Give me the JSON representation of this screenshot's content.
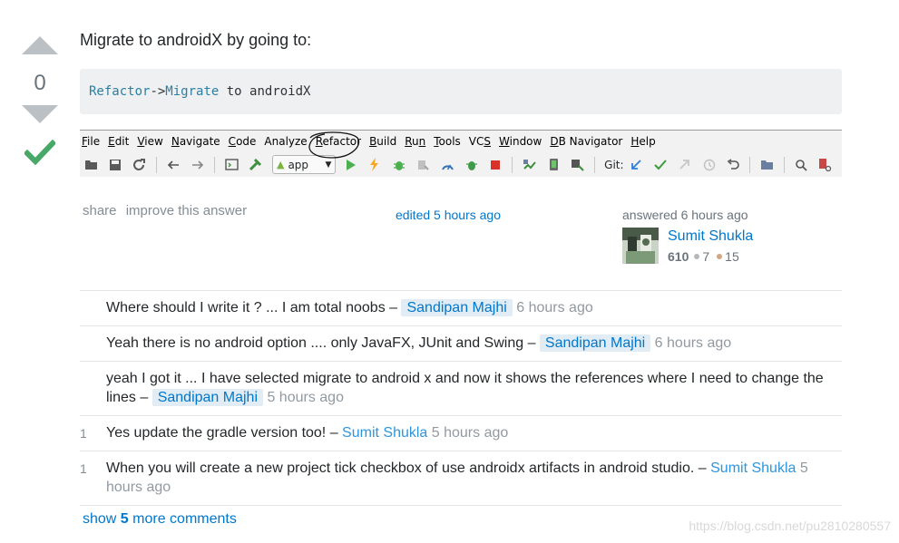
{
  "vote": {
    "count": "0"
  },
  "post": {
    "intro": "Migrate to androidX by going to:",
    "code": {
      "menu1": "Refactor",
      "sep": "->",
      "menu2": "Migrate",
      "rest": " to androidX"
    }
  },
  "ide": {
    "menus": [
      {
        "u": "F",
        "r": "ile"
      },
      {
        "u": "E",
        "r": "dit"
      },
      {
        "u": "V",
        "r": "iew"
      },
      {
        "u": "N",
        "r": "avigate"
      },
      {
        "u": "C",
        "r": "ode"
      },
      {
        "u": "",
        "r": "Analyze"
      },
      {
        "u": "R",
        "r": "efactor"
      },
      {
        "u": "B",
        "r": "uild"
      },
      {
        "u": "R",
        "r": "u",
        "r2": "n"
      },
      {
        "u": "T",
        "r": "ools"
      },
      {
        "u": "",
        "r": "VC",
        "u2": "S"
      },
      {
        "u": "W",
        "r": "indow"
      },
      {
        "u": "D",
        "r": "B Navigator"
      },
      {
        "u": "H",
        "r": "elp"
      }
    ],
    "run_config": "app",
    "git_label": "Git:",
    "colors": {
      "green": "#4caf50",
      "blue": "#2f7ed8",
      "red": "#d9322b",
      "orange": "#f5a623"
    }
  },
  "meta": {
    "share": "share",
    "improve": "improve this answer",
    "edited": "edited 5 hours ago",
    "answered": "answered 6 hours ago",
    "user_name": "Sumit Shukla",
    "rep": "610",
    "silver": "7",
    "bronze": "15"
  },
  "comments": [
    {
      "score": "",
      "text": "Where should I write it ? ... I am total noobs – ",
      "author": "Sandipan Majhi",
      "date": "6 hours ago",
      "highlight": true
    },
    {
      "score": "",
      "text": "Yeah there is no android option .... only JavaFX, JUnit and Swing – ",
      "author": "Sandipan Majhi",
      "date": "6 hours ago",
      "highlight": true
    },
    {
      "score": "",
      "text": "yeah I got it ... I have selected migrate to android x and now it shows the references where I need to change the lines – ",
      "author": "Sandipan Majhi",
      "date": "5 hours ago",
      "highlight": true
    },
    {
      "score": "1",
      "text": "Yes update the gradle version too! – ",
      "author": "Sumit Shukla",
      "date": "5 hours ago",
      "highlight": false
    },
    {
      "score": "1",
      "text": "When you will create a new project tick checkbox of use androidx artifacts in android studio. – ",
      "author": "Sumit Shukla",
      "date": "5 hours ago",
      "highlight": false
    }
  ],
  "show_more": {
    "prefix": "show ",
    "count": "5",
    "suffix": " more comments"
  },
  "watermark": "https://blog.csdn.net/pu2810280557"
}
